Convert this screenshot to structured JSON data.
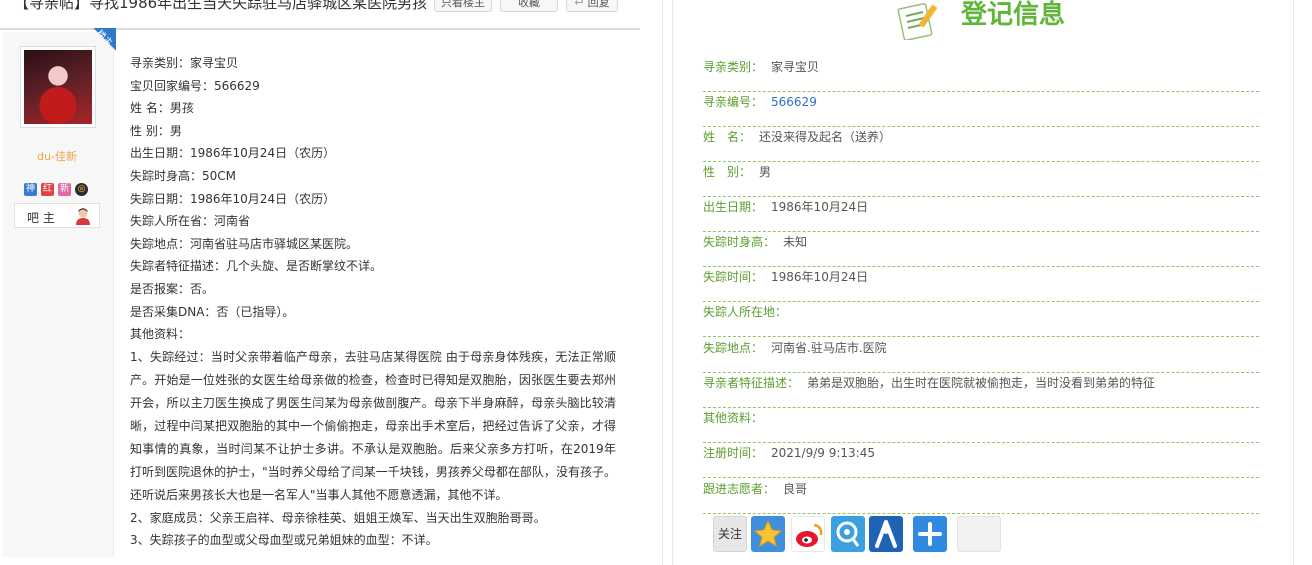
{
  "left": {
    "post_title": "【寻亲帖】寻找1986年出生当天失踪驻马店驿城区某医院男孩",
    "buttons": {
      "only_op": "只看楼主",
      "favorite": "收藏",
      "reply": "回复"
    },
    "corner_badge": "楼主",
    "user": {
      "name": "du-佳新",
      "badges": [
        "神",
        "红",
        "新",
        "◎"
      ],
      "role": "吧 主"
    },
    "post_lines": [
      "寻亲类别：家寻宝贝",
      "宝贝回家编号：566629",
      "姓 名：男孩",
      "性 别：男",
      "出生日期：1986年10月24日（农历）",
      "失踪时身高：50CM",
      "失踪日期：1986年10月24日（农历）",
      "失踪人所在省：河南省",
      "失踪地点：河南省驻马店市驿城区某医院。",
      "失踪者特征描述：几个头旋、是否断掌纹不详。",
      "是否报案：否。",
      "是否采集DNA：否（已指导）。",
      "其他资料："
    ],
    "paragraph_1": "1、失踪经过：当时父亲带着临产母亲，去驻马店某得医院 由于母亲身体残疾，无法正常顺产。开始是一位姓张的女医生给母亲做的检查，检查时已得知是双胞胎，因张医生要去郑州开会，所以主刀医生换成了男医生闫某为母亲做剖腹产。母亲下半身麻醉，母亲头脑比较清晰，过程中闫某把双胞胎的其中一个偷偷抱走，母亲出手术室后，把经过告诉了父亲，才得知事情的真象，当时闫某不让护士多讲。不承认是双胞胎。后来父亲多方打听，在2019年打听到医院退休的护士，\"当时养父母给了闫某一千块钱，男孩养父母都在部队，没有孩子。还听说后来男孩长大也是一名军人\"当事人其他不愿意透漏，其他不详。",
    "line_family": "2、家庭成员：父亲王启祥、母亲徐桂英、姐姐王焕军、当天出生双胞胎哥哥。",
    "line_blood": "3、失踪孩子的血型或父母血型或兄弟姐妹的血型：不详。"
  },
  "right": {
    "title": "登记信息",
    "rows": [
      {
        "label": "寻亲类别：",
        "value": "家寻宝贝"
      },
      {
        "label": "寻亲编号：",
        "value": "566629"
      },
      {
        "label": "姓　名：",
        "value": "还没来得及起名（送养）"
      },
      {
        "label": "性　别：",
        "value": "男"
      },
      {
        "label": "出生日期：",
        "value": "1986年10月24日"
      },
      {
        "label": "失踪时身高：",
        "value": "未知"
      },
      {
        "label": "失踪时间：",
        "value": "1986年10月24日"
      },
      {
        "label": "失踪人所在地：",
        "value": ""
      },
      {
        "label": "失踪地点：",
        "value": "河南省.驻马店市.医院"
      },
      {
        "label": "寻亲者特征描述：",
        "value": "弟弟是双胞胎，出生时在医院就被偷抱走，当时没看到弟弟的特征"
      },
      {
        "label": "其他资料：",
        "value": ""
      },
      {
        "label": "注册时间：",
        "value": "2021/9/9 9:13:45"
      },
      {
        "label": "跟进志愿者：",
        "value": "良哥"
      }
    ],
    "share": {
      "follow_label": "关注"
    }
  },
  "colors": {
    "accent_green": "#5fb63a",
    "label_green": "#5b9e2e",
    "link_blue": "#2d6fc4",
    "username_orange": "#f0a24a"
  },
  "icons": [
    "reply-icon",
    "register-notepad-icon",
    "bazhu-avatar-icon",
    "qzone-star-icon",
    "weibo-icon",
    "tencent-weibo-icon",
    "renren-icon",
    "more-share-icon"
  ]
}
